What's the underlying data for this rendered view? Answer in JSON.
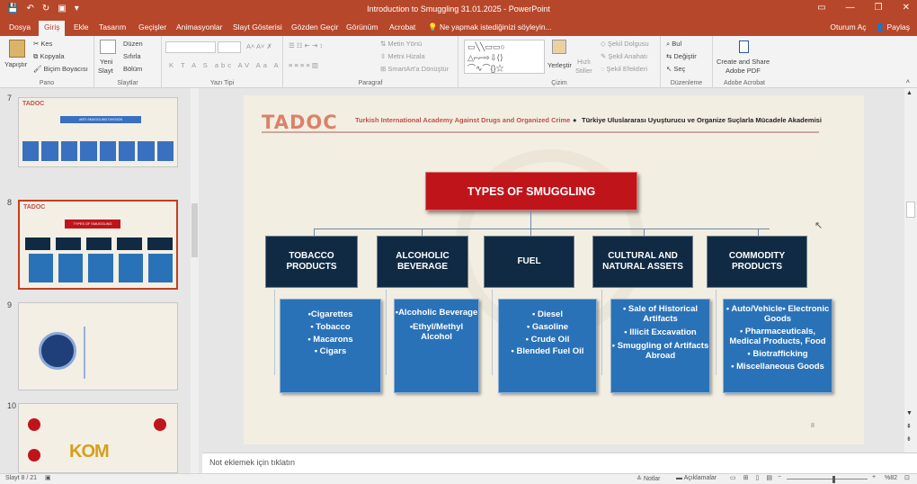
{
  "window": {
    "title": "Introduction to Smuggling 31.01.2025 - PowerPoint",
    "sign_in": "Oturum Aç",
    "share": "Paylaş"
  },
  "tabs": [
    "Dosya",
    "Giriş",
    "Ekle",
    "Tasarım",
    "Geçişler",
    "Animasyonlar",
    "Slayt Gösterisi",
    "Gözden Geçir",
    "Görünüm",
    "Acrobat"
  ],
  "tell_me": "Ne yapmak istediğinizi söyleyin...",
  "ribbon": {
    "clipboard": {
      "paste": "Yapıştır",
      "cut": "Kes",
      "copy": "Kopyala",
      "format_painter": "Biçim Boyacısı",
      "label": "Pano"
    },
    "slides": {
      "new_slide": "Yeni",
      "new_slide2": "Slayt",
      "layout": "Düzen",
      "reset": "Sıfırla",
      "section": "Bölüm",
      "label": "Slaytlar"
    },
    "font": {
      "label": "Yazı Tipi",
      "buttons": [
        "K",
        "T",
        "A",
        "S",
        "abc",
        "AV",
        "Aa",
        "A"
      ]
    },
    "paragraph": {
      "text_direction": "Metin Yönü",
      "align_text": "Metni Hizala",
      "smartart": "SmartArt'a Dönüştür",
      "label": "Paragraf"
    },
    "drawing": {
      "arrange": "Yerleştir",
      "quick_styles": "Hızlı",
      "quick_styles2": "Stiller",
      "shape_fill": "Şekil Dolgusu",
      "shape_outline": "Şekil Anahatı",
      "shape_effects": "Şekil Efektleri",
      "label": "Çizim"
    },
    "editing": {
      "find": "Bul",
      "replace": "Değiştir",
      "select": "Seç",
      "label": "Düzenleme"
    },
    "acrobat": {
      "create": "Create and Share",
      "create2": "Adobe PDF",
      "label": "Adobe Acrobat"
    }
  },
  "thumbnails": [
    {
      "num": "7",
      "title": "ANTI-SMUGGLING DIVISION"
    },
    {
      "num": "8",
      "title": "TYPES OF SMUGGLING"
    },
    {
      "num": "9",
      "title": ""
    },
    {
      "num": "10",
      "title": "KOM"
    }
  ],
  "slide": {
    "logo": "TADOC",
    "academy_en": "Turkish International Academy Against Drugs and Organized Crime",
    "bullet": "●",
    "academy_tr": "Türkiye Uluslararası Uyuşturucu ve Organize Suçlarla Mücadele Akademisi",
    "title": "TYPES OF SMUGGLING",
    "page_number": "8",
    "categories": [
      {
        "name": "TOBACCO PRODUCTS",
        "items": [
          "•Cigarettes",
          "• Tobacco",
          "• Macarons",
          "• Cigars"
        ]
      },
      {
        "name": "ALCOHOLIC BEVERAGE",
        "items": [
          "•Alcoholic Beverage",
          "•Ethyl/Methyl Alcohol"
        ]
      },
      {
        "name": "FUEL",
        "items": [
          "• Diesel",
          "• Gasoline",
          "• Crude Oil",
          "• Blended Fuel Oil"
        ]
      },
      {
        "name": "CULTURAL AND NATURAL ASSETS",
        "items": [
          "• Sale of Historical Artifacts",
          "• Illicit Excavation",
          "• Smuggling of Artifacts Abroad"
        ]
      },
      {
        "name": "COMMODITY PRODUCTS",
        "items": [
          "• Auto/Vehicle• Electronic Goods",
          "• Pharmaceuticals, Medical Products, Food",
          "• Biotrafficking",
          "• Miscellaneous Goods"
        ]
      }
    ]
  },
  "notes_placeholder": "Not eklemek için tıklatın",
  "status": {
    "slide": "Slayt 8 / 21",
    "notes": "Notlar",
    "comments": "Açıklamalar",
    "zoom": "%82"
  },
  "colors": {
    "accent": "#b7472a",
    "title_box": "#c0141b",
    "header_box": "#102a43",
    "body_box": "#2a72b8"
  }
}
